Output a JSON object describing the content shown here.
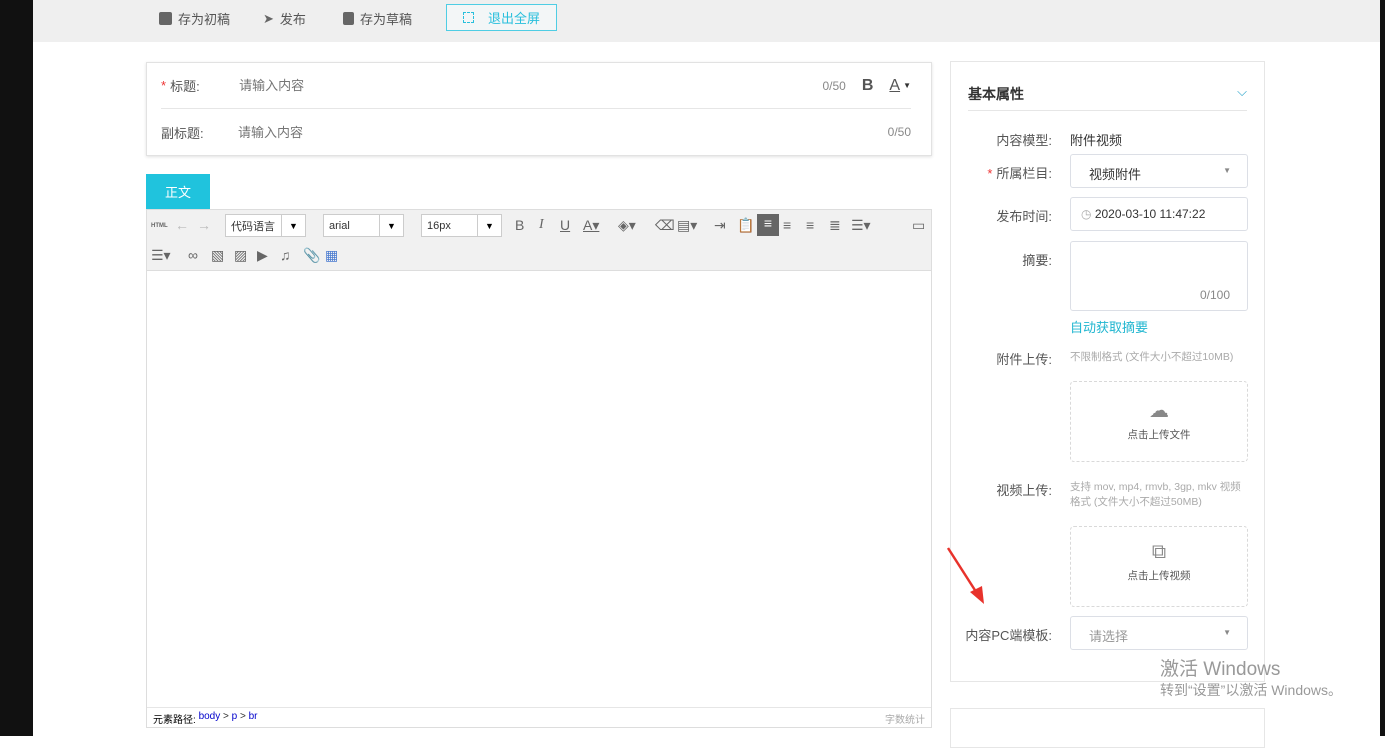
{
  "topbar": {
    "save_first": "存为初稿",
    "publish": "发布",
    "save_draft": "存为草稿",
    "exit_fullscreen": "退出全屏"
  },
  "title_card": {
    "title_label": "标题:",
    "title_placeholder": "请输入内容",
    "title_count": "0/50",
    "bold": "B",
    "font_color": "A",
    "subtitle_label": "副标题:",
    "subtitle_placeholder": "请输入内容",
    "subtitle_count": "0/50"
  },
  "editor": {
    "tab": "正文",
    "html": "HTML",
    "code_lang": "代码语言",
    "font": "arial",
    "size": "16px",
    "path_label": "元素路径:",
    "path": [
      "body",
      "p",
      "br"
    ],
    "word_count": "字数统计"
  },
  "panel": {
    "title": "基本属性",
    "model_label": "内容模型:",
    "model_value": "附件视频",
    "column_label": "所属栏目:",
    "column_value": "视频附件",
    "time_label": "发布时间:",
    "time_value": "2020-03-10 11:47:22",
    "summary_label": "摘要:",
    "summary_count": "0/100",
    "auto_summary": "自动获取摘要",
    "attach_label": "附件上传:",
    "attach_hint": "不限制格式 (文件大小不超过10MB)",
    "attach_button": "点击上传文件",
    "video_label": "视频上传:",
    "video_hint": "支持 mov, mp4, rmvb, 3gp, mkv 视频格式 (文件大小不超过50MB)",
    "video_button": "点击上传视频",
    "template_label": "内容PC端模板:",
    "template_placeholder": "请选择"
  },
  "watermark": {
    "line1": "激活 Windows",
    "line2": "转到“设置”以激活 Windows。"
  },
  "colors": {
    "accent": "#20c3dd",
    "required": "#e33333",
    "arrow": "#e8322b"
  }
}
